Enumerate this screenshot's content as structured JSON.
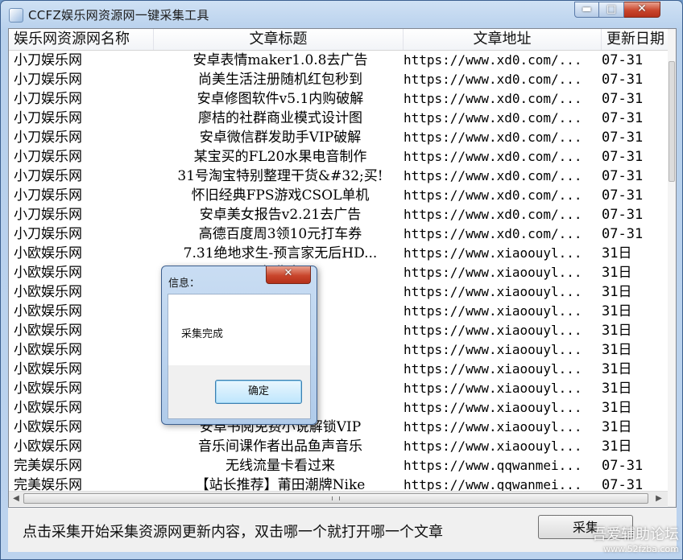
{
  "window": {
    "title": "CCFZ娱乐网资源网一键采集工具",
    "controls": {
      "minimize": "▬",
      "maximize": "□",
      "close": "✕"
    }
  },
  "table": {
    "columns": [
      "娱乐网资源网名称",
      "文章标题",
      "文章地址",
      "更新日期"
    ],
    "rows": [
      [
        "小刀娱乐网",
        "安卓表情maker1.0.8去广告",
        "https://www.xd0.com/...",
        "07-31"
      ],
      [
        "小刀娱乐网",
        "尚美生活注册随机红包秒到",
        "https://www.xd0.com/...",
        "07-31"
      ],
      [
        "小刀娱乐网",
        "安卓修图软件v5.1内购破解",
        "https://www.xd0.com/...",
        "07-31"
      ],
      [
        "小刀娱乐网",
        "廖桔的社群商业模式设计图",
        "https://www.xd0.com/...",
        "07-31"
      ],
      [
        "小刀娱乐网",
        "安卓微信群发助手VIP破解",
        "https://www.xd0.com/...",
        "07-31"
      ],
      [
        "小刀娱乐网",
        "某宝买的FL20水果电音制作",
        "https://www.xd0.com/...",
        "07-31"
      ],
      [
        "小刀娱乐网",
        "31号淘宝特别整理干货&#32;买!",
        "https://www.xd0.com/...",
        "07-31"
      ],
      [
        "小刀娱乐网",
        "怀旧经典FPS游戏CSOL单机",
        "https://www.xd0.com/...",
        "07-31"
      ],
      [
        "小刀娱乐网",
        "安卓美女报告v2.21去广告",
        "https://www.xd0.com/...",
        "07-31"
      ],
      [
        "小刀娱乐网",
        "高德百度周3领10元打车券",
        "https://www.xd0.com/...",
        "07-31"
      ],
      [
        "小欧娱乐网",
        "7.31绝地求生-预言家无后HD...",
        "https://www.xiaoouyl...",
        "31日"
      ],
      [
        "小欧娱乐网",
        "                      免费爽",
        "https://www.xiaoouyl...",
        "31日"
      ],
      [
        "小欧娱乐网",
        "                      新破解版",
        "https://www.xiaoouyl...",
        "31日"
      ],
      [
        "小欧娱乐网",
        "                      IP破解",
        "https://www.xiaoouyl...",
        "31日"
      ],
      [
        "小欧娱乐网",
        "                      音制作",
        "https://www.xiaoouyl...",
        "31日"
      ],
      [
        "小欧娱乐网",
        "                      式设计图",
        "https://www.xiaoouyl...",
        "31日"
      ],
      [
        "小欧娱乐网",
        "                      OL单机",
        "https://www.xiaoouyl...",
        "31日"
      ],
      [
        "小欧娱乐网",
        "                      去广告",
        "https://www.xiaoouyl...",
        "31日"
      ],
      [
        "小欧娱乐网",
        "                      fv1.0.9",
        "https://www.xiaoouyl...",
        "31日"
      ],
      [
        "小欧娱乐网",
        "安卓书阅免费小说解锁VIP",
        "https://www.xiaoouyl...",
        "31日"
      ],
      [
        "小欧娱乐网",
        "音乐间课作者出品鱼声音乐",
        "https://www.xiaoouyl...",
        "31日"
      ],
      [
        "完美娱乐网",
        "无线流量卡看过来",
        "https://www.qqwanmei...",
        "07-31"
      ],
      [
        "完美娱乐网",
        "【站长推荐】莆田潮牌Nike",
        "https://www.qqwanmei...",
        "07-31"
      ]
    ]
  },
  "status": {
    "hint": "点击采集开始采集资源网更新内容，双击哪一个就打开哪一个文章",
    "collect_button": "采集"
  },
  "watermark": {
    "line1": "吾爱辅助论坛",
    "line2": "www.52fzba.com"
  },
  "dialog": {
    "title": "信息：",
    "message": "采集完成",
    "ok_button": "确定",
    "close": "✕"
  }
}
